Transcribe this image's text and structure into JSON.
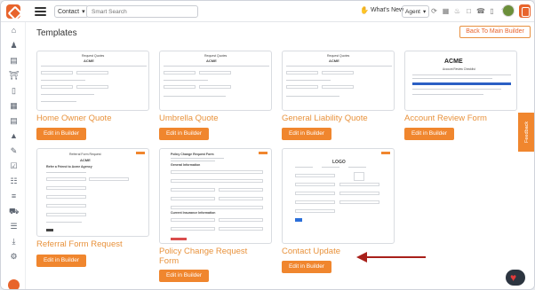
{
  "topbar": {
    "context": "Contact",
    "search_placeholder": "Smart Search",
    "whats_new": "What's New",
    "role": "Agent"
  },
  "main": {
    "title": "Templates",
    "back_button": "Back To Main Builder"
  },
  "templates": [
    {
      "name": "Home Owner Quote",
      "button": "Edit in Builder",
      "preview_title": "Request Quotes",
      "preview_brand": "ACME"
    },
    {
      "name": "Umbrella Quote",
      "button": "Edit in Builder",
      "preview_title": "Request Quotes",
      "preview_brand": "ACME"
    },
    {
      "name": "General Liability Quote",
      "button": "Edit in Builder",
      "preview_title": "Request Quotes",
      "preview_brand": "ACME"
    },
    {
      "name": "Account Review Form",
      "button": "Edit in Builder",
      "preview_title": "Account Review Checklist",
      "preview_brand": "ACME"
    },
    {
      "name": "Referral Form Request",
      "button": "Edit in Builder",
      "preview_title": "Referral Form Request",
      "preview_brand": "ACME",
      "preview_subtitle": "Refer a Friend to Acme Agency"
    },
    {
      "name": "Policy Change Request Form",
      "button": "Edit in Builder",
      "preview_title": "Policy Change Request Form",
      "preview_section1": "General Information",
      "preview_section2": "Current Insurance Information"
    },
    {
      "name": "Contact Update",
      "button": "Edit in Builder",
      "preview_title": "LOGO"
    }
  ],
  "feedback_label": "Feedback",
  "colors": {
    "accent": "#f0862e",
    "title": "#e8923c",
    "arrow": "#a8201a"
  }
}
